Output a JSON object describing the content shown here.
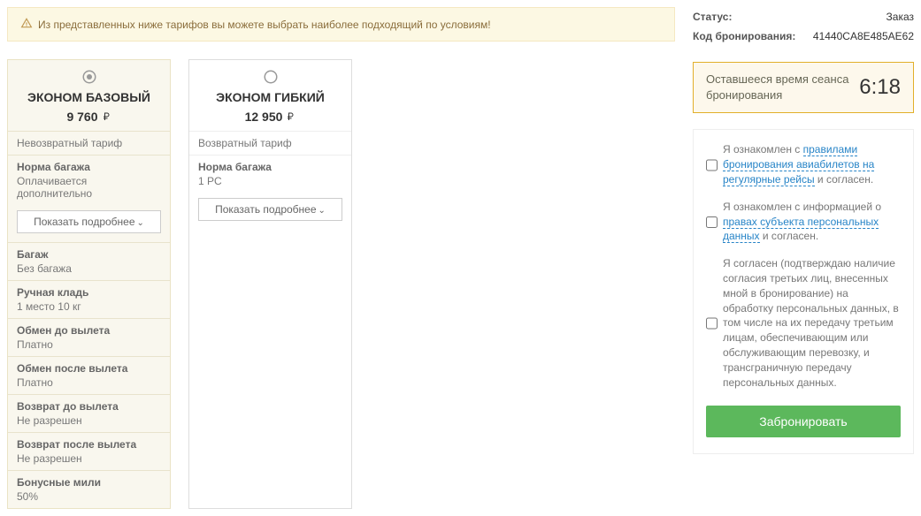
{
  "alert": {
    "text": "Из представленных ниже тарифов вы можете выбрать наиболее подходящий по условиям!"
  },
  "tariffs": [
    {
      "name": "ЭКОНОМ БАЗОВЫЙ",
      "price": "9 760",
      "refund": "Невозвратный тариф",
      "baggage_label": "Норма багажа",
      "baggage_value": "Оплачивается дополнительно",
      "show_more": "Показать подробнее",
      "details": [
        {
          "label": "Багаж",
          "value": "Без багажа"
        },
        {
          "label": "Ручная кладь",
          "value": "1 место 10 кг"
        },
        {
          "label": "Обмен до вылета",
          "value": "Платно"
        },
        {
          "label": "Обмен после вылета",
          "value": "Платно"
        },
        {
          "label": "Возврат до вылета",
          "value": "Не разрешен"
        },
        {
          "label": "Возврат после вылета",
          "value": "Не разрешен"
        },
        {
          "label": "Бонусные мили",
          "value": "50%"
        }
      ],
      "selected": true
    },
    {
      "name": "ЭКОНОМ ГИБКИЙ",
      "price": "12 950",
      "refund": "Возвратный тариф",
      "baggage_label": "Норма багажа",
      "baggage_value": "1 PC",
      "show_more": "Показать подробнее",
      "selected": false
    }
  ],
  "status": {
    "status_label": "Статус:",
    "status_value": "Заказ",
    "code_label": "Код бронирования:",
    "code_value": "41440CA8E485AE62"
  },
  "timer": {
    "label": "Оставшееся время сеанса бронирования",
    "value": "6:18"
  },
  "agreements": {
    "item1_pre": "Я ознакомлен с ",
    "item1_link": "правилами бронирования авиабилетов на регулярные рейсы",
    "item1_post": " и согласен.",
    "item2_pre": "Я ознакомлен с информацией о ",
    "item2_link": "правах субъекта персональных данных",
    "item2_post": " и согласен.",
    "item3": "Я согласен (подтверждаю наличие согласия третьих лиц, внесенных мной в бронирование) на обработку персональных данных, в том числе на их передачу третьим лицам, обеспечивающим или обслуживающим перевозку, и трансграничную передачу персональных данных."
  },
  "book_button": "Забронировать"
}
